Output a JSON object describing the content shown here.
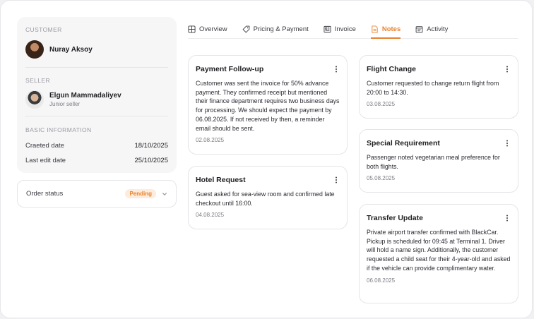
{
  "sidebar": {
    "customer": {
      "label": "CUSTOMER",
      "name": "Nuray Aksoy"
    },
    "seller": {
      "label": "SELLER",
      "name": "Elgun Mammadaliyev",
      "role": "Junior seller"
    },
    "basic_info": {
      "label": "BASIC INFORMATION",
      "created_label": "Craeted date",
      "created_value": "18/10/2025",
      "edited_label": "Last edit date",
      "edited_value": "25/10/2025"
    },
    "order_status": {
      "label": "Order status",
      "value": "Pending"
    }
  },
  "tabs": [
    {
      "label": "Overview",
      "icon": "grid-icon"
    },
    {
      "label": "Pricing & Payment",
      "icon": "tag-icon"
    },
    {
      "label": "Invoice",
      "icon": "invoice-icon"
    },
    {
      "label": "Notes",
      "icon": "note-icon",
      "active": true
    },
    {
      "label": "Activity",
      "icon": "calendar-icon"
    }
  ],
  "notes": [
    {
      "title": "Payment Follow-up",
      "body": "Customer was sent the invoice for 50% advance payment. They confirmed receipt but mentioned their finance department requires two business days for processing. We should expect the payment by 06.08.2025. If not received by then, a reminder email should be sent.",
      "date": "02.08.2025"
    },
    {
      "title": "Hotel Request",
      "body": "Guest asked for sea-view room and confirmed late checkout until 16:00.",
      "date": "04.08.2025"
    },
    {
      "title": "Flight Change",
      "body": "Customer requested to change return flight from 20:00 to 14:30.",
      "date": "03.08.2025"
    },
    {
      "title": "Special Requirement",
      "body": "Passenger noted vegetarian meal preference for both flights.",
      "date": "05.08.2025"
    },
    {
      "title": "Transfer Update",
      "body": "Private airport transfer confirmed with BlackCar. Pickup is scheduled for 09:45 at Terminal 1. Driver will hold a name sign. Additionally, the customer requested a child seat for their 4-year-old and asked if the vehicle can provide complimentary water.",
      "date": "06.08.2025"
    }
  ],
  "colors": {
    "accent": "#e9822e",
    "badge_bg": "#fdebdc",
    "panel_bg": "#f6f6f7"
  }
}
